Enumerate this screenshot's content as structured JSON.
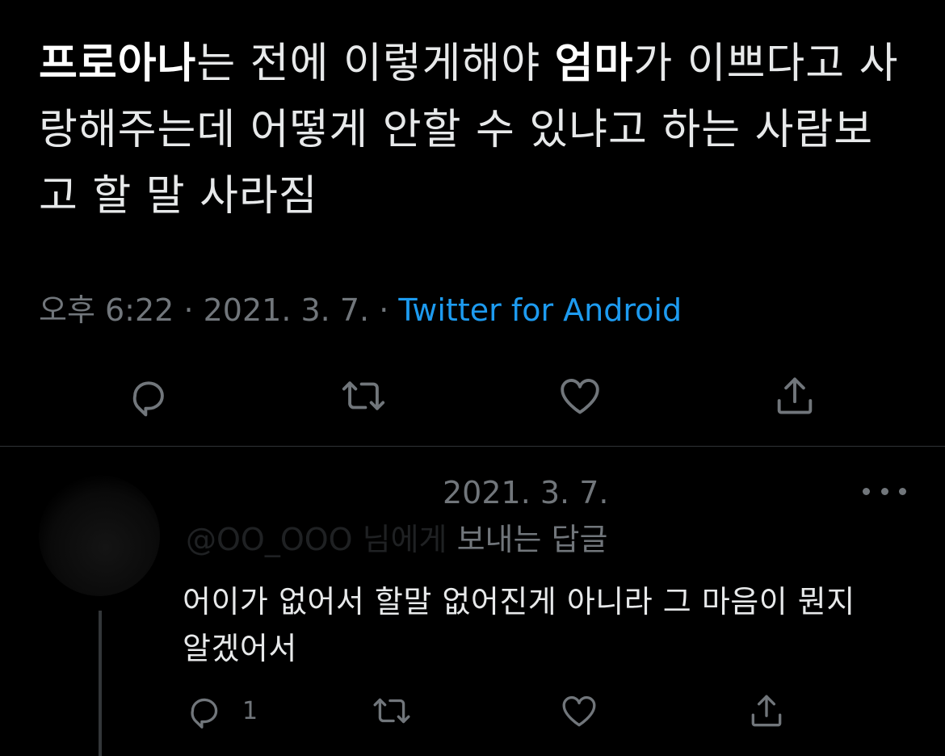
{
  "tweet": {
    "text_parts": [
      {
        "text": "프로아나",
        "bold": true
      },
      {
        "text": "는 전에 이렇게해야 ",
        "bold": false
      },
      {
        "text": "엄마",
        "bold": true
      },
      {
        "text": "가 이쁘다고 사랑해주는데 어떻게 안할 수 있냐고 하는 사람보고 할 말 사라짐",
        "bold": false
      }
    ],
    "time": "오후 6:22",
    "separator": "·",
    "date": "2021. 3. 7.",
    "source": "Twitter for Android"
  },
  "colors": {
    "background": "#000000",
    "text": "#e7e9ea",
    "muted": "#71767b",
    "link": "#1d9bf0",
    "divider": "#2f3336"
  },
  "actions": [
    {
      "name": "reply",
      "icon": "reply-icon"
    },
    {
      "name": "retweet",
      "icon": "retweet-icon"
    },
    {
      "name": "like",
      "icon": "heart-icon"
    },
    {
      "name": "share",
      "icon": "share-icon"
    }
  ],
  "reply": {
    "date": "2021. 3. 7.",
    "replying_to_blurred": "@OO_OOO 님에게",
    "replying_to_suffix": " 보내는 답글",
    "text": "어이가 없어서 할말 없어진게 아니라 그 마음이 뭔지 알겠어서",
    "reply_count": "1"
  }
}
